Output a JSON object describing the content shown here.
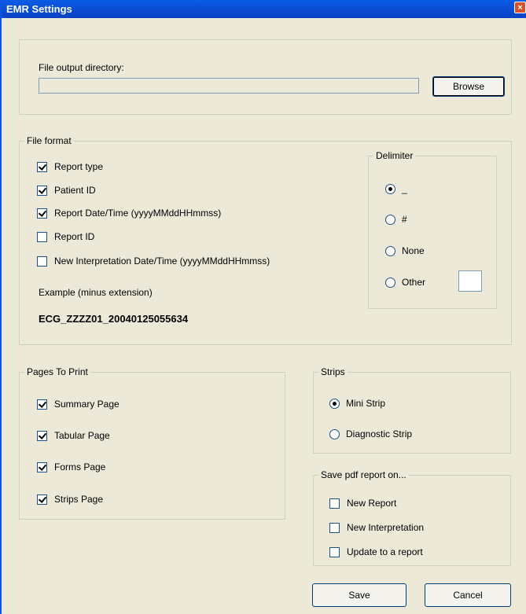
{
  "window": {
    "title": "EMR Settings",
    "close_glyph": "×"
  },
  "output": {
    "label": "File output directory:",
    "value": "",
    "browse_label": "Browse"
  },
  "file_format": {
    "legend": "File format",
    "items": [
      {
        "label": "Report type",
        "checked": true
      },
      {
        "label": "Patient ID",
        "checked": true
      },
      {
        "label": "Report Date/Time (yyyyMMddHHmmss)",
        "checked": true
      },
      {
        "label": "Report ID",
        "checked": false
      },
      {
        "label": "New Interpretation Date/Time (yyyyMMddHHmmss)",
        "checked": false
      }
    ],
    "example_label": "Example (minus extension)",
    "example_value": "ECG_ZZZZ01_20040125055634"
  },
  "delimiter": {
    "legend": "Delimiter",
    "options": [
      {
        "label": "_",
        "selected": true
      },
      {
        "label": "#",
        "selected": false
      },
      {
        "label": "None",
        "selected": false
      },
      {
        "label": "Other",
        "selected": false
      }
    ],
    "other_value": ""
  },
  "pages": {
    "legend": "Pages To Print",
    "items": [
      {
        "label": "Summary Page",
        "checked": true
      },
      {
        "label": "Tabular Page",
        "checked": true
      },
      {
        "label": "Forms Page",
        "checked": true
      },
      {
        "label": "Strips Page",
        "checked": true
      }
    ]
  },
  "strips": {
    "legend": "Strips",
    "options": [
      {
        "label": "Mini Strip",
        "selected": true
      },
      {
        "label": "Diagnostic Strip",
        "selected": false
      }
    ]
  },
  "save_pdf": {
    "legend": "Save pdf report on...",
    "items": [
      {
        "label": "New Report",
        "checked": false
      },
      {
        "label": "New Interpretation",
        "checked": false
      },
      {
        "label": "Update to a report",
        "checked": false
      }
    ]
  },
  "footer": {
    "save_label": "Save",
    "cancel_label": "Cancel"
  }
}
